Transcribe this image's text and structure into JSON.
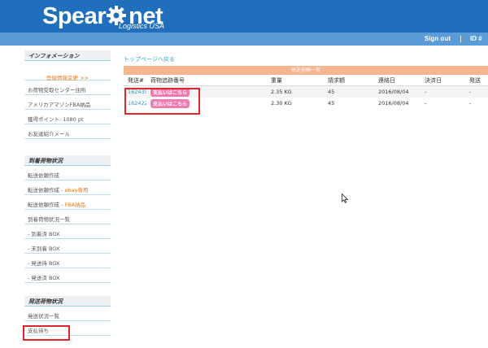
{
  "header": {
    "logo_main": "Spear",
    "logo_net": "net",
    "logo_sub": "Logistics USA",
    "sign_out": "Sign out",
    "separator": "|",
    "id_label": "ID #"
  },
  "sidebar": {
    "info_heading": "インフォメーション",
    "info_items": [
      "登録情報変更 >>",
      "お荷物受取センター住所",
      "アメリカアマゾンFBA納品",
      "獲得ポイント: 1080 pt",
      "お友達紹介メール"
    ],
    "arrival_heading": "到着荷物状況",
    "arrival_items": [
      {
        "main": "転送依頼作成",
        "accent": ""
      },
      {
        "main": "転送依頼作成 - ",
        "accent": "ebay専用"
      },
      {
        "main": "転送依頼作成 - ",
        "accent": "FBA納品"
      },
      {
        "main": "到着荷物状況一覧",
        "accent": ""
      },
      {
        "main": "- 到着済 BOX",
        "accent": ""
      },
      {
        "main": "- 未到着 BOX",
        "accent": ""
      },
      {
        "main": "- 発送待 BOX",
        "accent": ""
      },
      {
        "main": "- 発送済 BOX",
        "accent": ""
      }
    ],
    "shipping_heading": "発送荷物状況",
    "shipping_items": [
      "発送状況一覧",
      "支払待ち"
    ]
  },
  "main": {
    "back_link": "トップページへ戻る",
    "table_title": "発送依頼一覧",
    "columns": [
      "発送#",
      "荷物追跡番号",
      "重量",
      "請求額",
      "連絡日",
      "決済日",
      "発送"
    ],
    "rows": [
      {
        "id": "162435",
        "status": "支払いはこちら",
        "weight": "2.35 KG",
        "amount": "45",
        "contact_date": "2016/08/04",
        "payment_date": "-",
        "ship": "-"
      },
      {
        "id": "162422",
        "status": "支払いはこちら",
        "weight": "2.30 KG",
        "amount": "45",
        "contact_date": "2016/08/04",
        "payment_date": "-",
        "ship": "-"
      }
    ]
  },
  "colors": {
    "header_blue": "#1f6fbd",
    "topbar_blue": "#5a9bd8",
    "table_title_bg": "#f7b58e",
    "pay_badge": "#f27ab0",
    "highlight_red": "#e0262d",
    "accent_orange": "#f07a1e"
  }
}
